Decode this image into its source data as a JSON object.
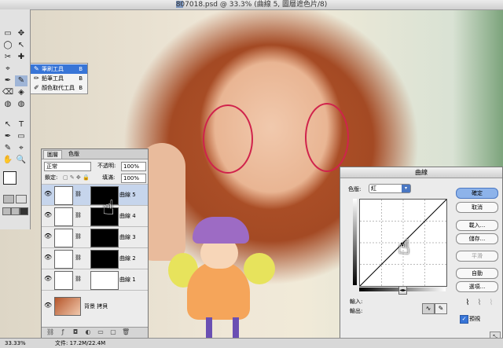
{
  "title_bar": {
    "text": "807018.psd @ 33.3% (曲線 5, 圖層遮色片/8)"
  },
  "toolbox": {
    "tools": [
      "↖",
      "✥",
      "▭",
      "◯",
      "✂",
      "✚",
      "⌖",
      "✎",
      "✒",
      "⌫",
      "◈",
      "◍",
      "✋",
      "T",
      "▭",
      "🔍"
    ]
  },
  "tool_flyout": {
    "items": [
      {
        "label": "筆刷工具",
        "key": "B"
      },
      {
        "label": "鉛筆工具",
        "key": "B"
      },
      {
        "label": "顏色取代工具",
        "key": "B"
      }
    ]
  },
  "layers_panel": {
    "tabs": [
      "圖層",
      "色版"
    ],
    "blend_mode": "正常",
    "opacity_label": "不透明:",
    "opacity_value": "100%",
    "lock_label": "鎖定:",
    "fill_label": "填滿:",
    "fill_value": "100%",
    "layers": [
      {
        "name": "曲線 5",
        "mask": "black",
        "selected": true
      },
      {
        "name": "曲線 4",
        "mask": "black",
        "selected": false
      },
      {
        "name": "曲線 3",
        "mask": "black",
        "selected": false
      },
      {
        "name": "曲線 2",
        "mask": "black",
        "selected": false
      },
      {
        "name": "曲線 1",
        "mask": "white",
        "selected": false
      }
    ],
    "background_layer": {
      "name": "背景 拷貝"
    }
  },
  "curves_dialog": {
    "title": "曲線",
    "channel_label": "色版:",
    "channel_value": "紅",
    "buttons": {
      "ok": "確定",
      "cancel": "取消",
      "load": "載入...",
      "save": "儲存...",
      "smooth": "平滑",
      "auto": "自動",
      "options": "選項..."
    },
    "input_label": "輸入:",
    "output_label": "輸出:",
    "preview_label": "預視",
    "preview_checked": true
  },
  "status_bar": {
    "zoom": "33.33%",
    "doc_info": "文件: 17.2M/22.4M"
  },
  "colors": {
    "annotation_circle": "#d0234c",
    "selection_blue": "#3875d7",
    "ok_button": "#8db3ea"
  }
}
